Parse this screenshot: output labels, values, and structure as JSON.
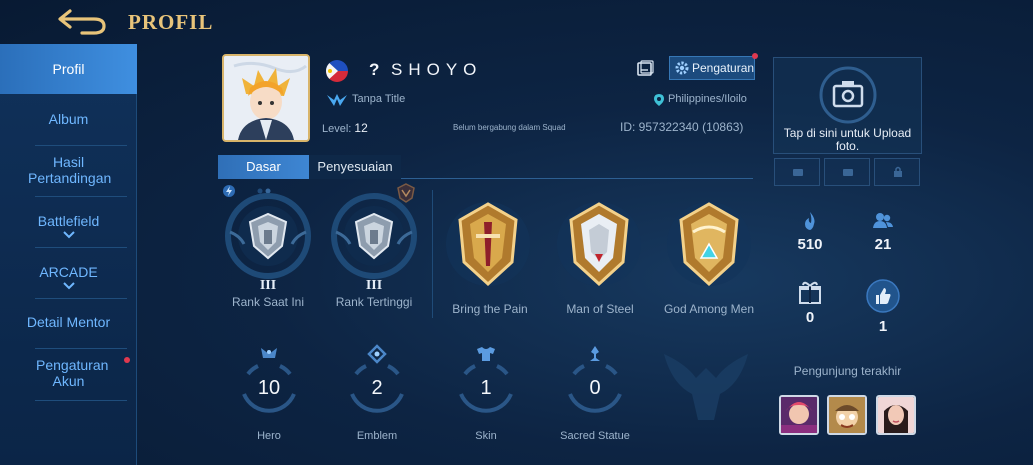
{
  "header": {
    "title": "PROFIL"
  },
  "sidebar": {
    "items": [
      {
        "label": "Profil"
      },
      {
        "label": "Album"
      },
      {
        "label": "Hasil Pertandingan"
      },
      {
        "label": "Battlefield"
      },
      {
        "label": "ARCADE"
      },
      {
        "label": "Detail Mentor"
      },
      {
        "label": "Pengaturan Akun"
      }
    ]
  },
  "profile": {
    "question_mark": "?",
    "name": "SHOYO",
    "title": "Tanpa Title",
    "level_label": "Level:",
    "level_value": "12",
    "squad_status": "Belum bergabung dalam Squad",
    "id_text": "ID: 957322340 (10863)",
    "location": "Philippines/Iloilo",
    "settings_label": "Pengaturan"
  },
  "tabs": [
    {
      "label": "Dasar"
    },
    {
      "label": "Penyesuaian"
    }
  ],
  "ranks": [
    {
      "roman": "III",
      "label": "Rank Saat Ini"
    },
    {
      "roman": "III",
      "label": "Rank Tertinggi"
    }
  ],
  "badges": [
    {
      "label": "Bring the Pain"
    },
    {
      "label": "Man of Steel"
    },
    {
      "label": "God Among Men"
    }
  ],
  "stats": [
    {
      "value": "10",
      "label": "Hero"
    },
    {
      "value": "2",
      "label": "Emblem"
    },
    {
      "value": "1",
      "label": "Skin"
    },
    {
      "value": "0",
      "label": "Sacred Statue"
    }
  ],
  "upload": {
    "text": "Tap di sini untuk Upload foto."
  },
  "right_stats": [
    {
      "icon": "flame-icon",
      "value": "510"
    },
    {
      "icon": "friends-icon",
      "value": "21"
    },
    {
      "icon": "gift-icon",
      "value": "0"
    },
    {
      "icon": "like-icon",
      "value": "1"
    }
  ],
  "visitors": {
    "label": "Pengunjung terakhir"
  },
  "colors": {
    "accent_gold": "#e8c47a",
    "active_blue": "#3f8fe0",
    "link_blue": "#6fb7ff",
    "notify_red": "#e0394f"
  }
}
